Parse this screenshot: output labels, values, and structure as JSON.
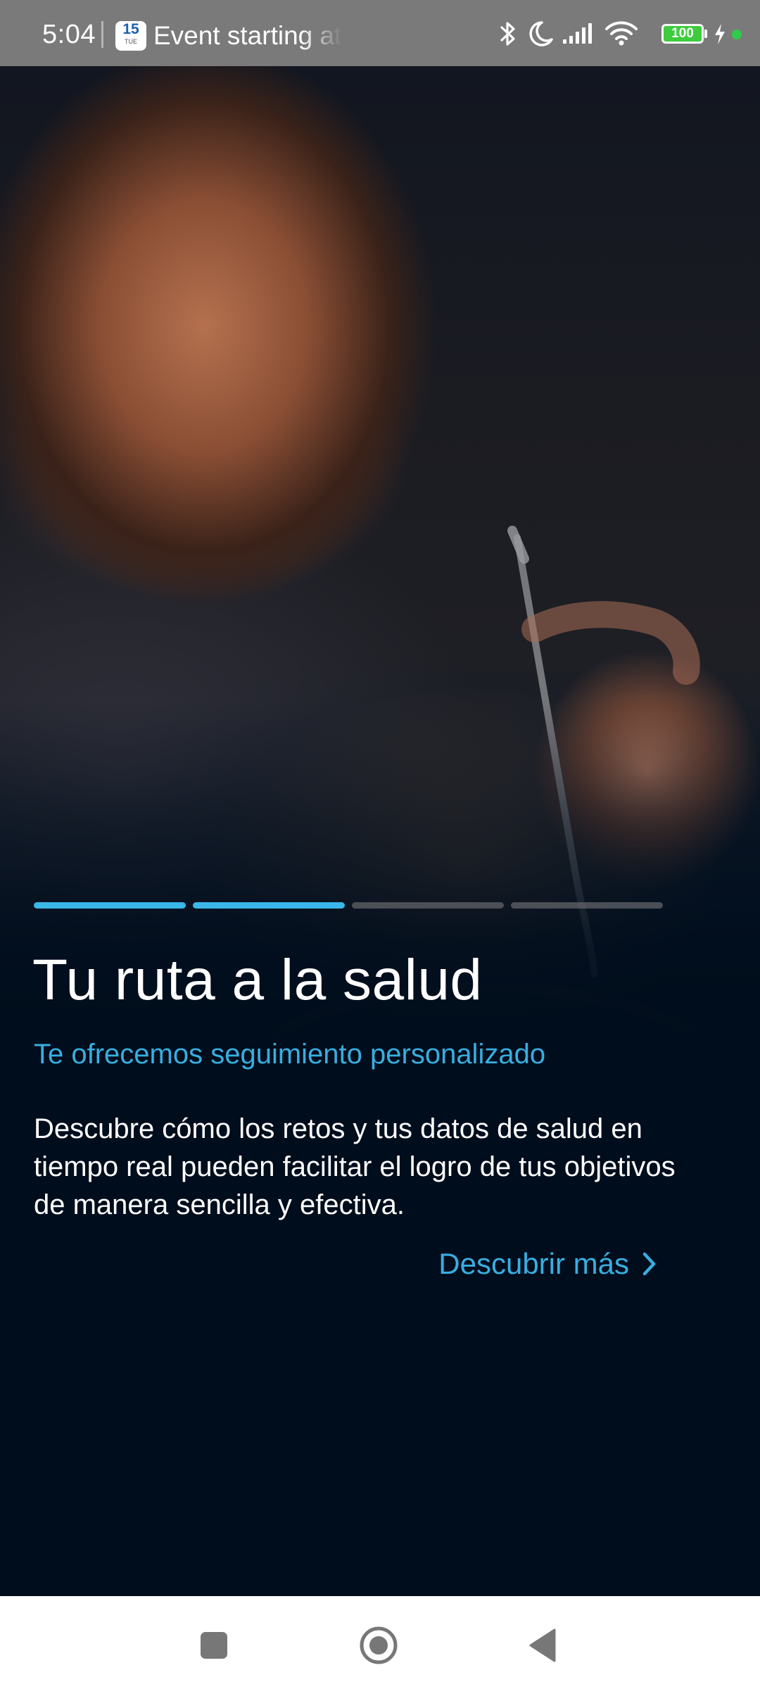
{
  "status_bar": {
    "time": "5:04",
    "notification_icon_day": "15",
    "notification_icon_sub": "TUE",
    "notification_text": "Event starting at",
    "battery_level": "100",
    "icons": [
      "calendar-icon",
      "bluetooth-icon",
      "moon-icon",
      "signal-icon",
      "wifi-icon",
      "battery-icon",
      "charging-icon",
      "green-dot-icon"
    ]
  },
  "onboarding": {
    "progress": {
      "total_steps": 4,
      "completed_steps": 2
    },
    "title": "Tu ruta a la salud",
    "subtitle": "Te ofrecemos seguimiento personalizado",
    "description": "Descubre cómo los retos y tus datos de salud en tiempo real pueden facilitar el logro de tus objetivos de manera sencilla y efectiva.",
    "link_label": "Descubrir más"
  },
  "nav_bar": {
    "buttons": [
      "recents-button",
      "home-button",
      "back-button"
    ]
  },
  "colors": {
    "accent": "#38aee0",
    "background": "#000d1c",
    "progress_inactive": "#5a5a5e",
    "status_bar": "#7a7a7a"
  }
}
